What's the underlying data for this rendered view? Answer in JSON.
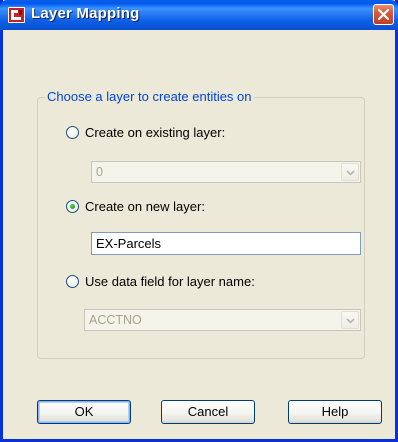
{
  "window": {
    "title": "Layer Mapping",
    "icons": {
      "app": "autocad-icon",
      "close": "close-icon"
    },
    "colors": {
      "title_bar": "#0A5FE8",
      "frame": "#0831D9",
      "close": "#D9573A",
      "group_title": "#0046D5",
      "dialog_bg": "#ECE9D8"
    }
  },
  "group": {
    "title": "Choose a layer to create entities on"
  },
  "options": {
    "existing": {
      "label": "Create on existing layer:",
      "selected": false,
      "value": "0"
    },
    "new_layer": {
      "label": "Create on new layer:",
      "selected": true,
      "value": "EX-Parcels"
    },
    "data_field": {
      "label": "Use data field for layer name:",
      "selected": false,
      "value": "ACCTNO"
    }
  },
  "buttons": {
    "ok": "OK",
    "cancel": "Cancel",
    "help": "Help"
  }
}
